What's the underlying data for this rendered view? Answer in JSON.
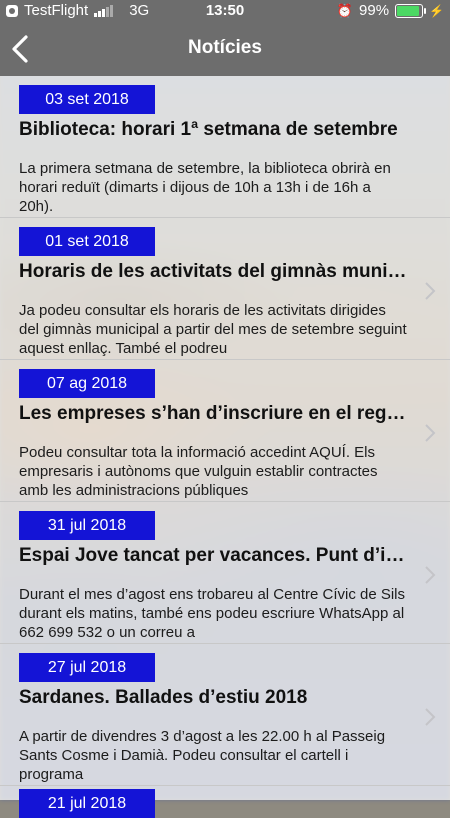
{
  "status_bar": {
    "carrier": "TestFlight",
    "network": "3G",
    "time": "13:50",
    "battery": "99%",
    "battery_level": 0.99
  },
  "nav": {
    "title": "Notícies"
  },
  "news": [
    {
      "date": "03 set 2018",
      "title": "Biblioteca: horari 1ª setmana de setembre",
      "body": "La primera setmana de setembre, la biblioteca obrirà en horari reduït (dimarts i dijous de 10h a 13h i de 16h a 20h)."
    },
    {
      "date": "01 set 2018",
      "title": "Horaris de les activitats del gimnàs municipal",
      "body": "Ja podeu consultar els horaris de les activitats dirigides del gimnàs municipal a partir del mes de setembre seguint aquest enllaç. També el podreu"
    },
    {
      "date": "07 ag 2018",
      "title": "Les empreses s’han d’inscriure en el registre",
      "body": "Podeu consultar tota la informació accedint AQUÍ. Els empresaris i autònoms que vulguin establir contractes amb les administracions públiques"
    },
    {
      "date": "31 jul 2018",
      "title": "Espai Jove tancat per vacances. Punt d’informació",
      "body": "Durant el mes d’agost ens trobareu al Centre Cívic de Sils durant els matins, també ens podeu escriure WhatsApp al 662 699 532 o un correu a"
    },
    {
      "date": "27 jul 2018",
      "title": "Sardanes. Ballades d’estiu 2018",
      "body": "A partir de divendres 3 d’agost a les 22.00 h al Passeig Sants Cosme i Damià. Podeu consultar el cartell i programa"
    }
  ],
  "partial_item": {
    "date": "21 jul 2018"
  },
  "colors": {
    "bar": "#6d6d6d",
    "date_badge": "#1414d6",
    "battery": "#4cd964"
  }
}
